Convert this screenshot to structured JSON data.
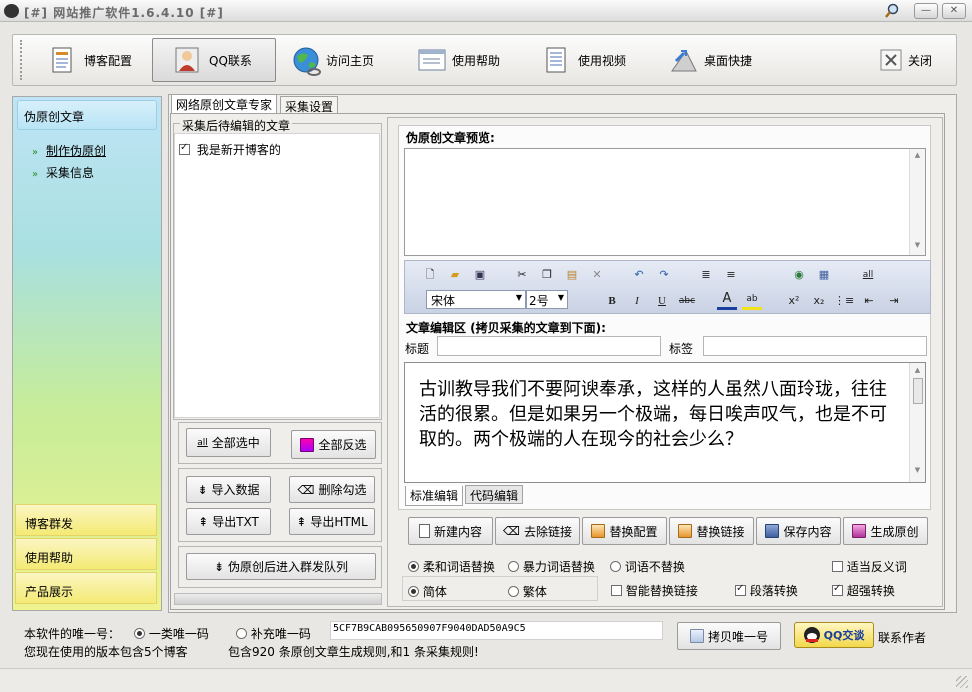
{
  "window": {
    "title": "[#] 网站推广软件1.6.4.10 [#]"
  },
  "toolbar": {
    "items": [
      {
        "label": "博客配置",
        "icon": "document-icon"
      },
      {
        "label": "QQ联系",
        "icon": "person-icon"
      },
      {
        "label": "访问主页",
        "icon": "globe-icon"
      },
      {
        "label": "使用帮助",
        "icon": "help-doc-icon"
      },
      {
        "label": "使用视频",
        "icon": "video-doc-icon"
      },
      {
        "label": "桌面快捷",
        "icon": "shortcut-icon"
      },
      {
        "label": "关闭",
        "icon": "close-icon"
      }
    ]
  },
  "sidebar": {
    "header": "伪原创文章",
    "items": [
      {
        "label": "制作伪原创"
      },
      {
        "label": "采集信息"
      }
    ],
    "bottom": [
      {
        "label": "博客群发"
      },
      {
        "label": "使用帮助"
      },
      {
        "label": "产品展示"
      }
    ]
  },
  "tabs": [
    {
      "label": "网络原创文章专家"
    },
    {
      "label": "采集设置"
    }
  ],
  "left_panel": {
    "group_title": "采集后待编辑的文章",
    "articles": [
      {
        "title": "我是新开博客的",
        "checked": true
      }
    ],
    "buttons": {
      "select_all": "全部选中",
      "invert": "全部反选",
      "import": "导入数据",
      "delete_checked": "删除勾选",
      "export_txt": "导出TXT",
      "export_html": "导出HTML",
      "queue": "伪原创后进入群发队列"
    }
  },
  "right_panel": {
    "preview_label": "伪原创文章预览:",
    "editor_font": "宋体",
    "editor_size": "2号",
    "edit_label": "文章编辑区 (拷贝采集的文章到下面):",
    "title_label": "标题",
    "tags_label": "标签",
    "editor_text": "古训教导我们不要阿谀奉承，这样的人虽然八面玲珑，往往活的很累。但是如果另一个极端，每日唉声叹气，也是不可取的。两个极端的人在现今的社会少么？",
    "editor_tabs": [
      "标准编辑",
      "代码编辑"
    ],
    "action_buttons": [
      "新建内容",
      "去除链接",
      "替换配置",
      "替换链接",
      "保存内容",
      "生成原创"
    ],
    "options": {
      "soft_replace": {
        "label": "柔和词语替换",
        "on": true
      },
      "violent_replace": {
        "label": "暴力词语替换",
        "on": false
      },
      "no_replace": {
        "label": "词语不替换",
        "on": false
      },
      "antonym": {
        "label": "适当反义词",
        "on": false
      },
      "simplified": {
        "label": "简体",
        "on": true
      },
      "traditional": {
        "label": "繁体",
        "on": false
      },
      "smart_link": {
        "label": "智能替换链接",
        "on": false
      },
      "paragraph": {
        "label": "段落转换",
        "on": true
      },
      "super": {
        "label": "超强转换",
        "on": true
      }
    }
  },
  "footer": {
    "unique_label": "本软件的唯一号：",
    "radio1": "一类唯一码",
    "radio2": "补充唯一码",
    "code": "5CF7B9CAB095650907F9040DAD50A9C5",
    "copy_button": "拷贝唯一号",
    "qq_button": "QQ交谈",
    "contact": "联系作者",
    "version_info": "您现在使用的版本包含5个博客",
    "rules_info": "包含920 条原创文章生成规则,和1 条采集规则!"
  }
}
